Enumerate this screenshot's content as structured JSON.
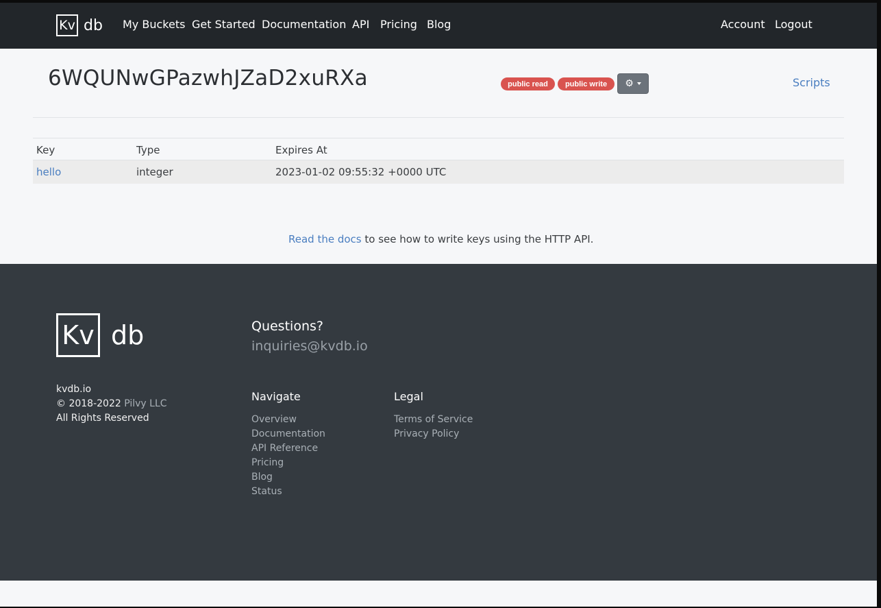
{
  "nav": {
    "logo_kv": "Kv",
    "logo_db": "db",
    "links": [
      "My Buckets",
      "Get Started",
      "Documentation",
      "API",
      "Pricing",
      "Blog"
    ],
    "account": "Account",
    "logout": "Logout"
  },
  "bucket": {
    "name": "6WQUNwGPazwhJZaD2xuRXa",
    "badges": [
      "public read",
      "public write"
    ],
    "settings_icon": "gear-icon",
    "scripts_label": "Scripts"
  },
  "table": {
    "headers": [
      "Key",
      "Type",
      "Expires At"
    ],
    "rows": [
      [
        "hello",
        "integer",
        "2023-01-02 09:55:32 +0000 UTC"
      ]
    ]
  },
  "docs_hint": {
    "link_text": "Read the docs",
    "rest": " to see how to write keys using the HTTP API."
  },
  "footer": {
    "site": "kvdb.io",
    "copyright_prefix": "© 2018-2022 ",
    "company": "Pilvy LLC",
    "rights": "All Rights Reserved",
    "questions": "Questions?",
    "email": "inquiries@kvdb.io",
    "navigate_heading": "Navigate",
    "navigate_links": [
      "Overview",
      "Documentation",
      "API Reference",
      "Pricing",
      "Blog",
      "Status"
    ],
    "legal_heading": "Legal",
    "legal_links": [
      "Terms of Service",
      "Privacy Policy"
    ]
  },
  "colors": {
    "nav_bg": "#22262a",
    "badge_red": "#d9534f",
    "link_blue": "#4a7ec0",
    "footer_bg": "#343a40"
  }
}
